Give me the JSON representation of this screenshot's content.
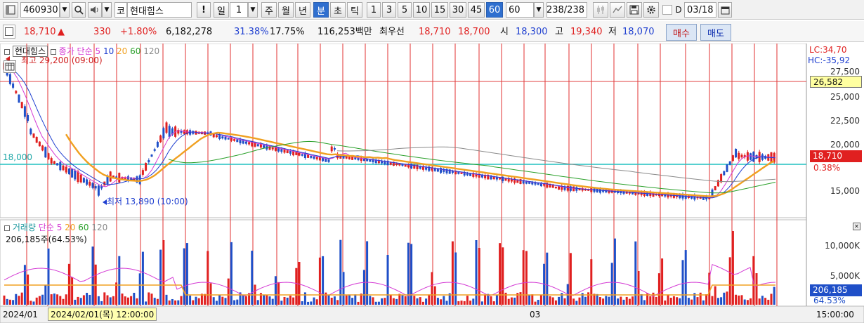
{
  "toolbar": {
    "stock_code": "460930",
    "market_badge": "코",
    "stock_name": "현대힘스",
    "warning_label": "!",
    "period_label": "일",
    "period_value": "1",
    "week_label": "주",
    "month_label": "월",
    "year_label": "년",
    "minute_label": "분",
    "second_label": "초",
    "tick_label": "틱",
    "intervals": [
      "1",
      "3",
      "5",
      "10",
      "15",
      "30",
      "45",
      "60"
    ],
    "interval_active": "60",
    "interval_select": "60",
    "count_value": "238",
    "count_total": "/238",
    "date_value": "03/18",
    "d_label": "D"
  },
  "quote": {
    "price": "18,710",
    "change": "330",
    "change_rate": "+1.80%",
    "volume": "6,182,278",
    "ratio1": "31.38%",
    "ratio2": "17.75%",
    "amount": "116,253백만",
    "best_label": "최우선",
    "ask": "18,710",
    "bid": "18,700",
    "open_label": "시",
    "open": "18,300",
    "high_label": "고",
    "high": "19,340",
    "low_label": "저",
    "low": "18,070",
    "buy_label": "매수",
    "sell_label": "매도"
  },
  "price_panel": {
    "legend_name": "현대힘스",
    "legend_type": "종가 단순",
    "ma": [
      "5",
      "10",
      "20",
      "60",
      "120"
    ],
    "high_marker": "최고 29,200 (09:00)",
    "low_marker": "최저 13,890 (10:00)",
    "hline_label": "18,000",
    "lc": "LC:34,70",
    "hc": "HC:-35,92",
    "axis": [
      "27,500",
      "25,000",
      "22,500",
      "20,000",
      "15,000"
    ],
    "tag_upper": "26,582",
    "tag_price": "18,710",
    "tag_pct": "0.38%"
  },
  "volume_panel": {
    "legend_name": "거래량",
    "legend_type": "단순",
    "ma": [
      "5",
      "20",
      "60",
      "120"
    ],
    "current": "206,185주(64.53%)",
    "axis": [
      "10,000K",
      "5,000K"
    ],
    "tag_value": "206,185",
    "tag_pct": "64.53%"
  },
  "time_axis": {
    "start": "2024/01",
    "cursor": "2024/02/01(목) 12:00:00",
    "march": "03",
    "end_time": "15:00:00"
  },
  "colors": {
    "up": "#e02020",
    "down": "#1f4fc8",
    "ma5": "#d43ad4",
    "ma10": "#1f3fd0",
    "ma20": "#f0a020",
    "ma60": "#2aa02a",
    "ma120": "#8a8a8a",
    "hline": "#20c0c0",
    "grid_v": "#e03030"
  }
}
